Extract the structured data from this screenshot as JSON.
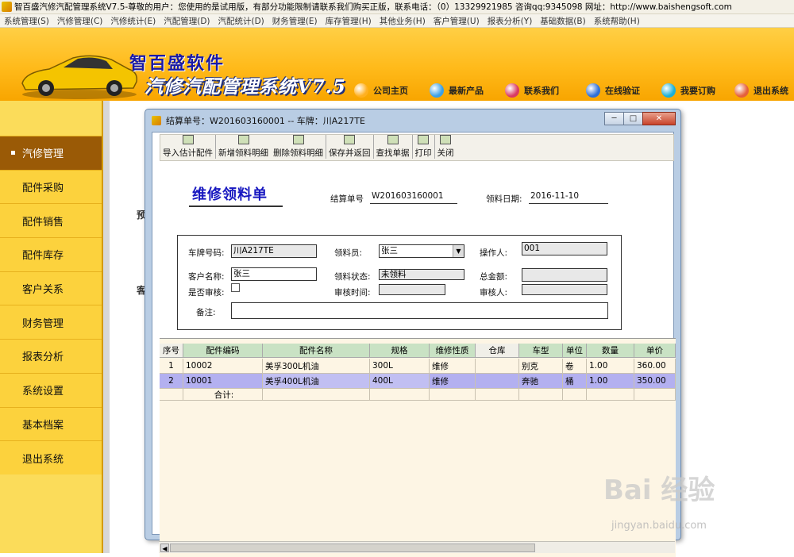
{
  "app": {
    "title": "智百盛汽修汽配管理系统V7.5-尊敬的用户：您使用的是试用版，有部分功能限制请联系我们购买正版，联系电话：（0）13329921985  咨询qq:9345098   网址：http://www.baishengsoft.com",
    "menu": [
      "系统管理(S)",
      "汽修管理(C)",
      "汽修统计(E)",
      "汽配管理(D)",
      "汽配统计(D)",
      "财务管理(E)",
      "库存管理(H)",
      "其他业务(H)",
      "客户管理(U)",
      "报表分析(Y)",
      "基础数据(B)",
      "系统帮助(H)"
    ]
  },
  "header": {
    "brand_top": "智百盛软件",
    "brand_main": "汽修汽配管理系统V7.5",
    "nav": [
      {
        "label": "公司主页",
        "icon": "home-icon",
        "color": "#ffb020"
      },
      {
        "label": "最新产品",
        "icon": "pinwheel-icon",
        "color": "#3aa0e8"
      },
      {
        "label": "联系我们",
        "icon": "contact-icon",
        "color": "#d93a63"
      },
      {
        "label": "在线验证",
        "icon": "verify-icon",
        "color": "#2f6fd6"
      },
      {
        "label": "我要订购",
        "icon": "order-icon",
        "color": "#19b0d8"
      },
      {
        "label": "退出系统",
        "icon": "exit-icon",
        "color": "#e5603a"
      }
    ]
  },
  "sidebar": {
    "items": [
      {
        "label": "汽修管理",
        "active": true
      },
      {
        "label": "配件采购"
      },
      {
        "label": "配件销售"
      },
      {
        "label": "配件库存"
      },
      {
        "label": "客户关系"
      },
      {
        "label": "财务管理"
      },
      {
        "label": "报表分析"
      },
      {
        "label": "系统设置"
      },
      {
        "label": "基本档案"
      },
      {
        "label": "退出系统"
      }
    ]
  },
  "background_fragments": [
    "预",
    "客"
  ],
  "dialog": {
    "title": "结算单号：W201603160001 -- 车牌：川A217TE",
    "toolbar": [
      {
        "label": "导入估计配件",
        "icon": "import-icon"
      },
      {
        "label": "新增领料明细",
        "icon": "add-detail-icon"
      },
      {
        "label": "删除领料明细",
        "icon": "delete-detail-icon"
      },
      {
        "label": "保存并返回",
        "icon": "save-icon"
      },
      {
        "label": "查找单据",
        "icon": "find-icon"
      },
      {
        "label": "打印",
        "icon": "print-icon"
      },
      {
        "label": "关闭",
        "icon": "close-door-icon"
      }
    ],
    "form_title": "维修领料单",
    "settle_no_label": "结算单号",
    "settle_no": "W201603160001",
    "pick_date_label": "领料日期:",
    "pick_date": "2016-11-10",
    "plate_label": "车牌号码:",
    "plate": "川A217TE",
    "picker_label": "领料员:",
    "picker": "张三",
    "operator_label": "操作人:",
    "operator": "001",
    "customer_label": "客户名称:",
    "customer": "张三",
    "status_label": "领料状态:",
    "status": "未领料",
    "total_label": "总金额:",
    "total": "",
    "audited_label": "是否审核:",
    "audit_time_label": "审核时间:",
    "audit_time": "",
    "auditor_label": "审核人:",
    "auditor": "",
    "remark_label": "备注:",
    "remark": "",
    "grid": {
      "columns": [
        "序号",
        "配件编码",
        "配件名称",
        "规格",
        "维修性质",
        "仓库",
        "车型",
        "单位",
        "数量",
        "单价"
      ],
      "rows": [
        [
          "1",
          "10002",
          "美孚300L机油",
          "300L",
          "维修",
          "",
          "别克",
          "卷",
          "1.00",
          "360.00"
        ],
        [
          "2",
          "10001",
          "美孚400L机油",
          "400L",
          "维修",
          "",
          "奔驰",
          "桶",
          "1.00",
          "350.00"
        ]
      ],
      "total_row_label": "合计:"
    }
  },
  "watermark": {
    "main": "Bai 经验",
    "sub": "jingyan.baidu.com"
  }
}
